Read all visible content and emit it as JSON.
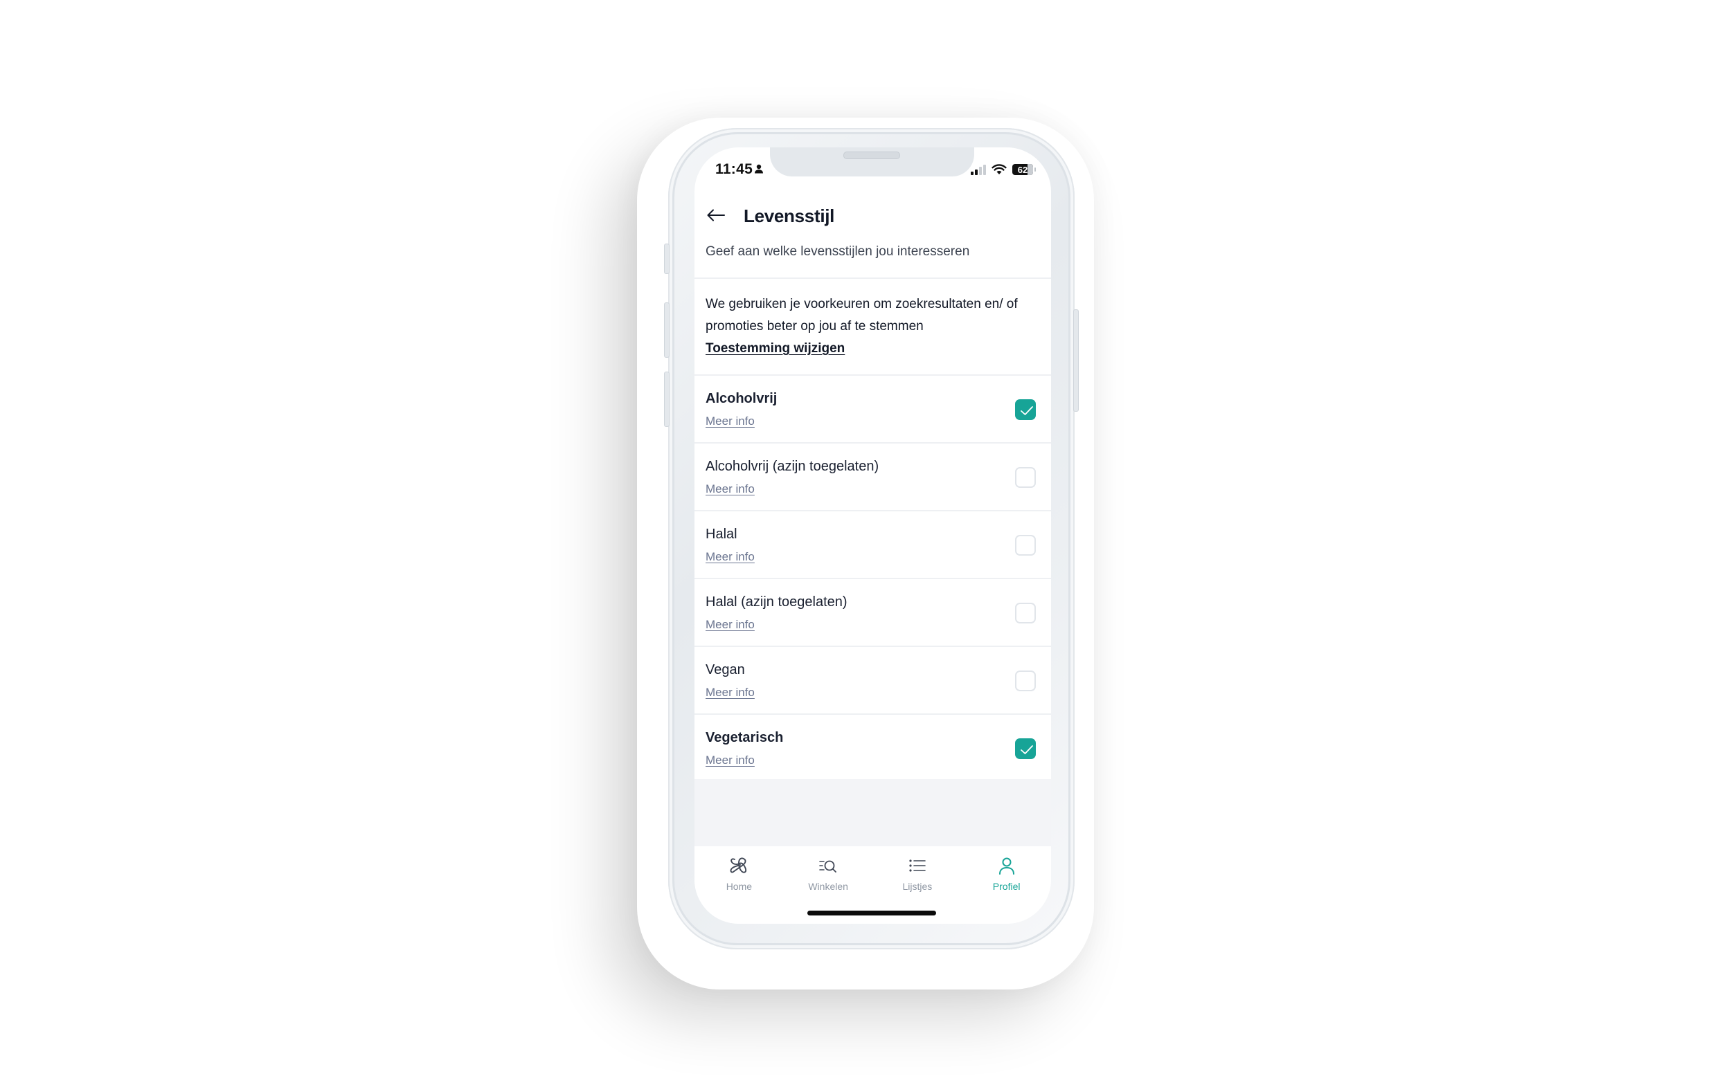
{
  "status_bar": {
    "time": "11:45",
    "battery": "62",
    "signal_bars_active": 2,
    "signal_bars_total": 4
  },
  "header": {
    "back_icon": "arrow-left-icon",
    "title": "Levensstijl",
    "subtitle": "Geef aan welke levensstijlen jou interesseren"
  },
  "info": {
    "text": "We gebruiken je voorkeuren om zoekresultaten en/ of promoties beter op jou af te stemmen",
    "link": "Toestemming wijzigen"
  },
  "lifestyles": [
    {
      "label": "Alcoholvrij",
      "more": "Meer info",
      "checked": true
    },
    {
      "label": "Alcoholvrij (azijn toegelaten)",
      "more": "Meer info",
      "checked": false
    },
    {
      "label": "Halal",
      "more": "Meer info",
      "checked": false
    },
    {
      "label": "Halal (azijn toegelaten)",
      "more": "Meer info",
      "checked": false
    },
    {
      "label": "Vegan",
      "more": "Meer info",
      "checked": false
    },
    {
      "label": "Vegetarisch",
      "more": "Meer info",
      "checked": true
    }
  ],
  "nav": [
    {
      "label": "Home",
      "icon": "home-icon",
      "active": false
    },
    {
      "label": "Winkelen",
      "icon": "shop-search-icon",
      "active": false
    },
    {
      "label": "Lijstjes",
      "icon": "list-icon",
      "active": false
    },
    {
      "label": "Profiel",
      "icon": "profile-icon",
      "active": true
    }
  ],
  "colors": {
    "accent": "#17a497",
    "text": "#121826",
    "muted": "#6b7590",
    "nav_inactive": "#8f97a3"
  }
}
